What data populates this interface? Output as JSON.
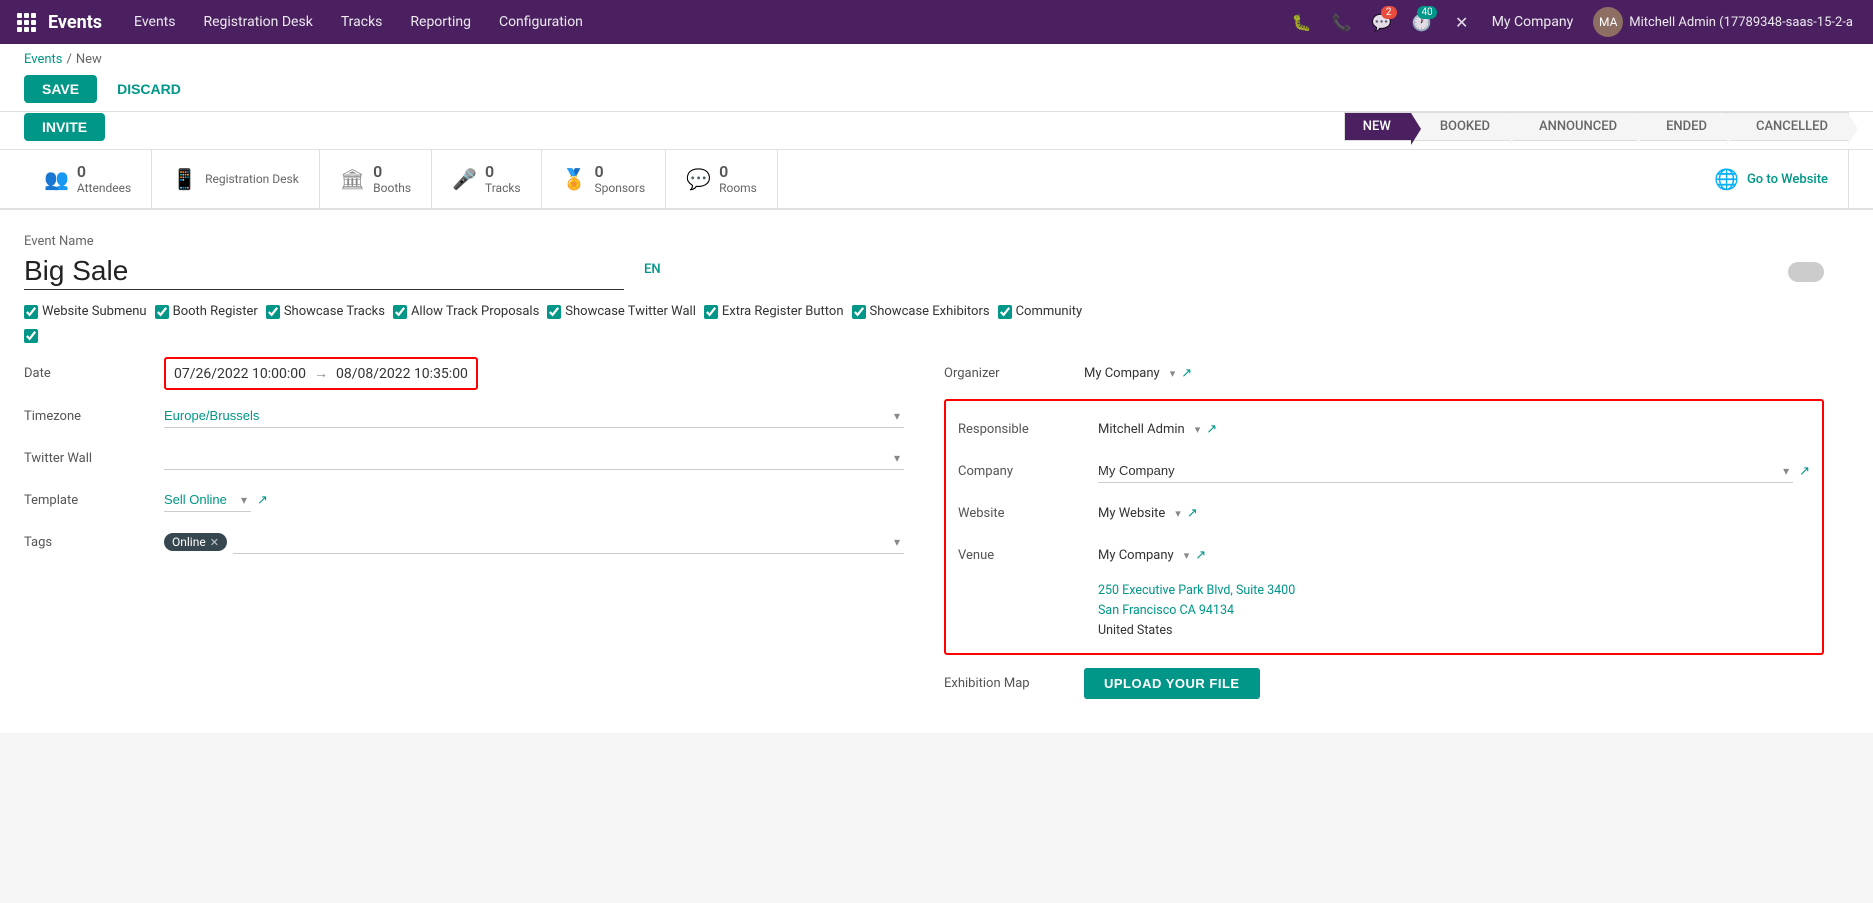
{
  "topnav": {
    "brand": "Events",
    "nav_items": [
      "Events",
      "Registration Desk",
      "Tracks",
      "Reporting",
      "Configuration"
    ],
    "badge_chat": "2",
    "badge_activity": "40",
    "company": "My Company",
    "user": "Mitchell Admin (17789348-saas-15-2-a"
  },
  "breadcrumb": {
    "parent": "Events",
    "current": "New"
  },
  "toolbar": {
    "save_label": "SAVE",
    "discard_label": "DISCARD",
    "invite_label": "INVITE"
  },
  "status_steps": [
    "NEW",
    "BOOKED",
    "ANNOUNCED",
    "ENDED",
    "CANCELLED"
  ],
  "active_step": "NEW",
  "smart_buttons": [
    {
      "icon": "👥",
      "count": "0",
      "label": "Attendees"
    },
    {
      "icon": "📱",
      "count": "",
      "label": "Registration Desk"
    },
    {
      "icon": "🏛",
      "count": "0",
      "label": "Booths"
    },
    {
      "icon": "🎤",
      "count": "0",
      "label": "Tracks"
    },
    {
      "icon": "🏅",
      "count": "0",
      "label": "Sponsors"
    },
    {
      "icon": "💬",
      "count": "0",
      "label": "Rooms"
    },
    {
      "icon": "🌐",
      "count": "",
      "label": "Go to Website"
    }
  ],
  "form": {
    "event_name_label": "Event Name",
    "event_name_value": "Big Sale",
    "lang": "EN",
    "checkboxes": [
      {
        "id": "website_submenu",
        "label": "Website Submenu",
        "checked": true
      },
      {
        "id": "booth_register",
        "label": "Booth Register",
        "checked": true
      },
      {
        "id": "showcase_tracks",
        "label": "Showcase Tracks",
        "checked": true
      },
      {
        "id": "allow_track_proposals",
        "label": "Allow Track Proposals",
        "checked": true
      },
      {
        "id": "showcase_twitter_wall",
        "label": "Showcase Twitter Wall",
        "checked": true
      },
      {
        "id": "extra_register_button",
        "label": "Extra Register Button",
        "checked": true
      },
      {
        "id": "showcase_exhibitors",
        "label": "Showcase Exhibitors",
        "checked": true
      },
      {
        "id": "community",
        "label": "Community",
        "checked": true
      }
    ],
    "left": {
      "date_label": "Date",
      "date_start": "07/26/2022 10:00:00",
      "date_end": "08/08/2022 10:35:00",
      "timezone_label": "Timezone",
      "timezone_value": "Europe/Brussels",
      "twitter_wall_label": "Twitter Wall",
      "twitter_wall_value": "",
      "template_label": "Template",
      "template_value": "Sell Online",
      "tags_label": "Tags",
      "tags": [
        "Online"
      ]
    },
    "right": {
      "organizer_label": "Organizer",
      "organizer_value": "My Company",
      "responsible_label": "Responsible",
      "responsible_value": "Mitchell Admin",
      "company_label": "Company",
      "company_value": "My Company",
      "website_label": "Website",
      "website_value": "My Website",
      "venue_label": "Venue",
      "venue_value": "My Company",
      "venue_address_line1": "250 Executive Park Blvd, Suite 3400",
      "venue_address_line2": "San Francisco CA 94134",
      "venue_address_line3": "United States",
      "exhibition_map_label": "Exhibition Map",
      "upload_btn_label": "UPLOAD YOUR FILE"
    }
  }
}
